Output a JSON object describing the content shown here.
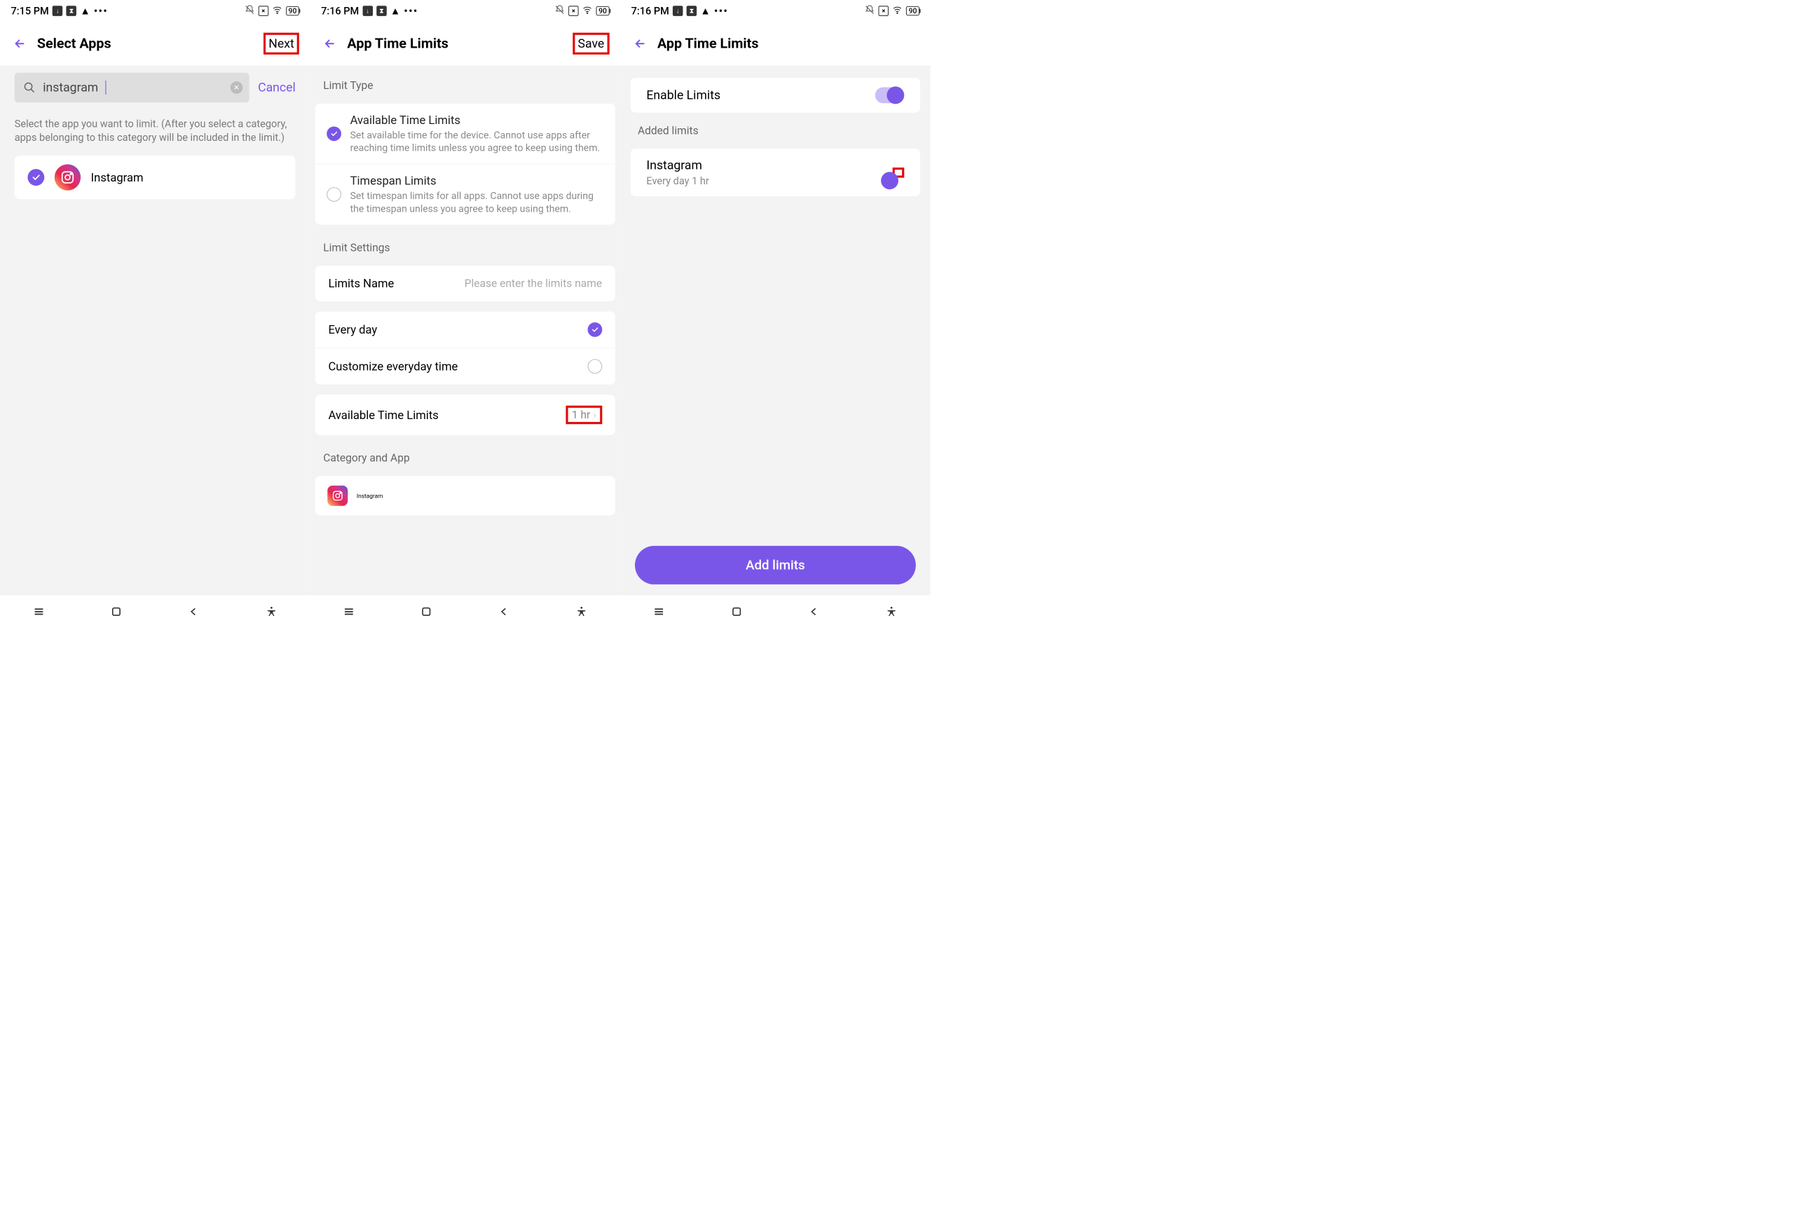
{
  "panel1": {
    "status_time": "7:15 PM",
    "battery": "90",
    "title": "Select Apps",
    "action": "Next",
    "search_value": "instagram",
    "cancel": "Cancel",
    "help": "Select the app you want to limit. (After you select a category, apps belonging to this category will be included in the limit.)",
    "app_name": "Instagram"
  },
  "panel2": {
    "status_time": "7:16 PM",
    "battery": "90",
    "title": "App Time Limits",
    "action": "Save",
    "limit_type_header": "Limit Type",
    "opt1_title": "Available Time Limits",
    "opt1_desc": "Set available time for the device. Cannot use apps after reaching time limits unless you agree to keep using them.",
    "opt2_title": "Timespan Limits",
    "opt2_desc": "Set timespan limits for all apps. Cannot use apps during the timespan unless you agree to keep using them.",
    "settings_header": "Limit Settings",
    "limits_name_label": "Limits Name",
    "limits_name_placeholder": "Please enter the limits name",
    "everyday_label": "Every day",
    "customize_label": "Customize everyday time",
    "available_label": "Available Time Limits",
    "available_value": "1 hr",
    "category_header": "Category and App",
    "app_name": "Instagram"
  },
  "panel3": {
    "status_time": "7:16 PM",
    "battery": "90",
    "title": "App Time Limits",
    "enable_label": "Enable Limits",
    "added_header": "Added limits",
    "limit_title": "Instagram",
    "limit_sub": "Every day 1 hr",
    "add_button": "Add limits"
  }
}
